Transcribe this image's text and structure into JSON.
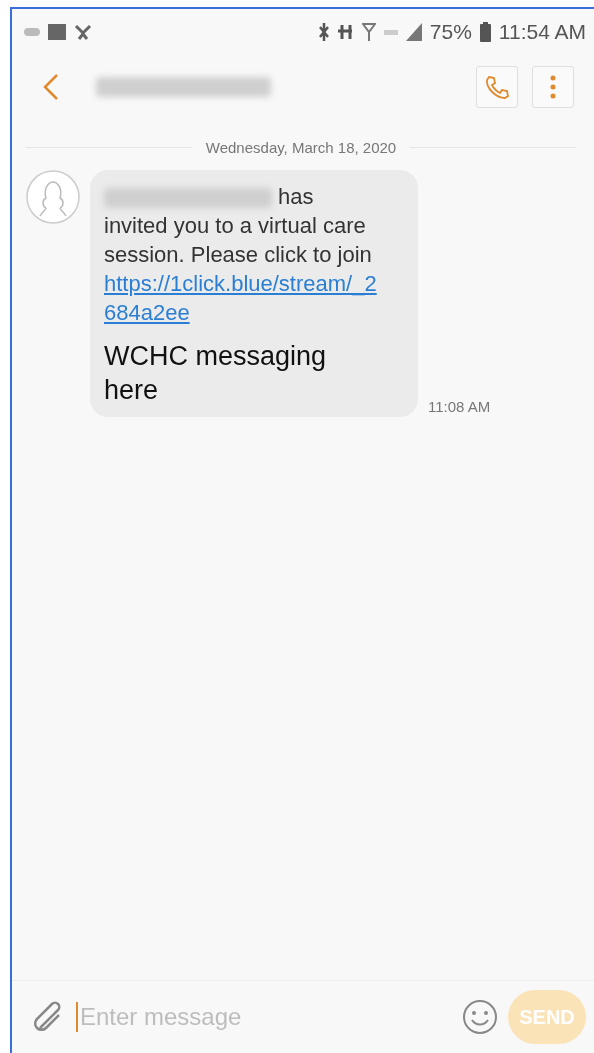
{
  "status_bar": {
    "battery": "75%",
    "time": "11:54 AM"
  },
  "header": {
    "title_redacted": true
  },
  "conversation": {
    "date": "Wednesday, March 18, 2020",
    "messages": [
      {
        "sender_redacted": true,
        "text": "has invited you to a virtual care session. Please click to join ",
        "link": "https://1click.blue/stream/_2684a2ee",
        "signature": "WCHC messaging here",
        "time": "11:08 AM"
      }
    ]
  },
  "composer": {
    "placeholder": "Enter message",
    "send": {
      "label": "SEND",
      "disabled": true
    }
  }
}
